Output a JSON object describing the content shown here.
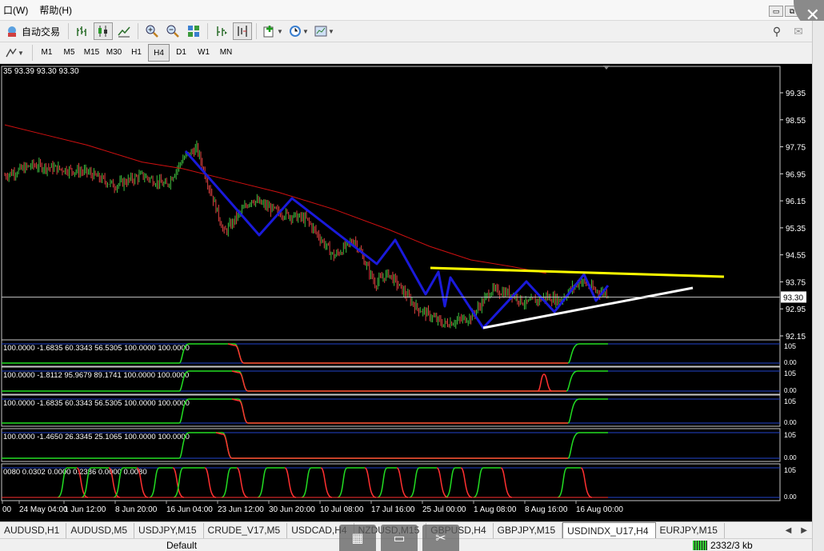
{
  "menu": {
    "items": [
      "口(W)",
      "帮助(H)"
    ]
  },
  "window": {
    "minimize": "▭",
    "restore": "⧉",
    "close": "✕"
  },
  "toolbar": {
    "autotrade_label": "自动交易",
    "icons": [
      "bar-chart-icon",
      "candlestick-icon",
      "line-chart-icon",
      "zoom-in-icon",
      "zoom-out-icon",
      "tile-windows-icon",
      "autoscroll-icon",
      "chart-shift-icon",
      "indicators-icon",
      "periods-icon",
      "templates-icon"
    ],
    "search_icon": "⚲",
    "chat_icon": "✉"
  },
  "timeframes": {
    "items": [
      "M1",
      "M5",
      "M15",
      "M30",
      "H1",
      "H4",
      "D1",
      "W1",
      "MN"
    ],
    "selected": "H4"
  },
  "chart": {
    "ohlc_text": "35 93.39 93.30 93.30",
    "price_labels": [
      "99.35",
      "98.55",
      "97.75",
      "96.95",
      "96.15",
      "95.35",
      "94.55",
      "93.75",
      "92.95",
      "92.15"
    ],
    "current_price": "93.30",
    "time_labels": [
      "00",
      "24 May 04:00",
      "1 Jun 12:00",
      "8 Jun 20:00",
      "16 Jun 04:00",
      "23 Jun 12:00",
      "30 Jun 20:00",
      "10 Jul 08:00",
      "17 Jul 16:00",
      "25 Jul 00:00",
      "1 Aug 08:00",
      "8 Aug 16:00",
      "16 Aug 00:00"
    ],
    "colors": {
      "bull": "#3fbf3f",
      "bear": "#e04040",
      "ma": "#d01010",
      "zigzag": "#1a1adb",
      "resistance": "#ffff00",
      "support": "#ffffff"
    }
  },
  "indicators": [
    {
      "text": "100.0000 -1.6835 60.3343 56.5305 100.0000 100.0000",
      "level_top": "105",
      "level_bottom": "0.00"
    },
    {
      "text": "100.0000 -1.8112 95.9679 89.1741 100.0000 100.0000",
      "level_top": "105",
      "level_bottom": "0.00"
    },
    {
      "text": "100.0000 -1.6835 60.3343 56.5305 100.0000 100.0000",
      "level_top": "105",
      "level_bottom": "0.00"
    },
    {
      "text": "100.0000 -1.4650 26.3345 25.1065 100.0000 100.0000",
      "level_top": "105",
      "level_bottom": "0.00"
    },
    {
      "text": "0080 0.0302 0.0000 0.2386 0.0000 0.0080",
      "level_top": "105",
      "level_bottom": "0.00"
    }
  ],
  "tabs": {
    "items": [
      "AUDUSD,H1",
      "AUDUSD,M5",
      "USDJPY,M15",
      "CRUDE_V17,M5",
      "USDCAD,H4",
      "NZDUSD,M15",
      "GBPUSD,H4",
      "GBPJPY,M15",
      "USDINDX_U17,H4",
      "EURJPY,M15"
    ],
    "active": "USDINDX_U17,H4"
  },
  "status": {
    "profile": "Default",
    "traffic": "2332/3 kb"
  }
}
